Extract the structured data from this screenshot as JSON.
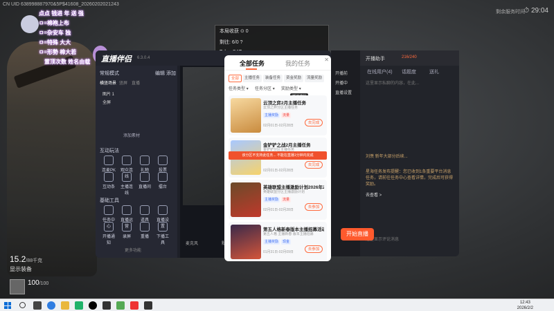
{
  "overlay": {
    "uid": "CN UID 638998887970&5P$41608_20260202021243",
    "clock_label": "剩余服务时间",
    "clock": "29:04",
    "danmaku": [
      "点点 钱进 年 送 强",
      "ㅁ=棉袍上布",
      "ㅁ=杂安车 独",
      "ㅁ=特殊 大大",
      "ㅁ=形勢 棉大若",
      "置顶次数 姓名由载"
    ],
    "hud_hp": "15.2",
    "hud_hp_unit": "/88千克",
    "hud_equip": "显示装备",
    "hud_health": "100",
    "hud_health_max": "/100"
  },
  "top_stats": {
    "title": "本局收获",
    "value": "0",
    "row1": "剩往: 6/0 ?",
    "row2": "Tabs: CAT"
  },
  "app": {
    "logo": "直播伴侣",
    "version": "6.3.0.4",
    "scene_label": "常规模式",
    "scene_edit": "编辑",
    "scene_add": "添加",
    "scene_tabs": [
      "横竖场景",
      "竖屏",
      "直播"
    ],
    "items": [
      "图片 1",
      "全屏"
    ],
    "add_material": "添加素材",
    "interact_title": "互动玩法",
    "interact_tools": [
      "连麦PK",
      "观众连线",
      "礼物",
      "投票",
      "互动条",
      "主播连线",
      "直播间",
      "擂台",
      "刷盘"
    ],
    "basic_title": "基础工具",
    "basic_tools": [
      "任务中心",
      "直播运营",
      "道具",
      "直播设置",
      "开播通知",
      "录屏",
      "重播",
      "下播工具"
    ],
    "more_tools": "更多功能",
    "status_left": "麦克风",
    "status_mid": "默认"
  },
  "right_panel": {
    "header_btns": [
      "开播前",
      "开播中",
      "直播设置"
    ],
    "assistant_title": "开播助手",
    "assistant_count": "216/240",
    "tabs": [
      "在线用户(4)",
      "话题度",
      "送礼"
    ],
    "text_grey1": "这里显示私聊的内容，在此...",
    "text_gold1": "刘羡 新年大部分后续...",
    "text_gold2": "星海任务发布提醒：您已收到1条重要平台消息任务，请前往任务中心查看详情，完成后可获得奖励。",
    "link": "去查看 >",
    "text_grey2": "这里显示评论消息",
    "start_button": "开始直播"
  },
  "modal": {
    "tab_all": "全部任务",
    "tab_mine": "我的任务",
    "chips": [
      "全部",
      "主播任务",
      "装备任务",
      "资金奖励",
      "流量奖励"
    ],
    "filters": [
      "任务类型",
      "任务分区",
      "奖励类型"
    ],
    "tooltip": "抓达成就",
    "cards": [
      {
        "title": "云顶之弈2月主播任务",
        "sub": "云顶之弈分区主播任务",
        "badges": [
          "主播奖励",
          "流量"
        ],
        "date": "02月01日-02月28日",
        "action": "去完成"
      },
      {
        "title": "金铲铲之战2月主播任务",
        "sub": "金铲铲分区主播任务",
        "badges": [
          "主播奖励",
          "流量"
        ],
        "date": "02月01日-02月28日",
        "action": "去完成",
        "warning": "该分区不支持此任务... 不能在直播1分钟内完成"
      },
      {
        "title": "英雄联盟主播激励计划2026年2月",
        "sub": "英雄联盟分区主播激励计划",
        "badges": [
          "主播奖励",
          "流量"
        ],
        "date": "02月01日-02月28日",
        "action": "去参加"
      },
      {
        "title": "第五人格新春版本主播招募活动",
        "sub": "第五人格 主播新春 版本主播招募",
        "badges": [
          "主播奖励",
          "现金"
        ],
        "date": "01月31日-02月09日",
        "action": "去参加"
      }
    ]
  },
  "taskbar": {
    "time": "12:43",
    "date": "2026/2/2"
  },
  "colors": {
    "accent": "#ff6a3d",
    "start_button": "#ff5a2d",
    "warning_bar": "#f0512c",
    "gold_text": "#c9a26a"
  }
}
